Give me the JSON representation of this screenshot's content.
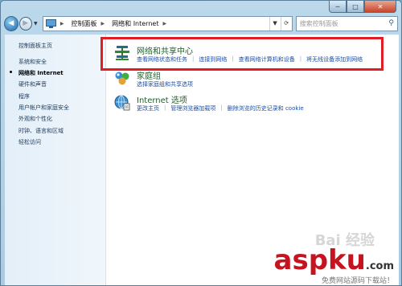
{
  "caption": {
    "minimize": "─",
    "maximize": "□",
    "close": "✕"
  },
  "breadcrumb": [
    "控制面板",
    "网络和 Internet"
  ],
  "search": {
    "placeholder": "搜索控制面板"
  },
  "left_pane": {
    "home": "控制面板主页",
    "items": [
      "系统和安全",
      "网络和 Internet",
      "硬件和声音",
      "程序",
      "用户帐户和家庭安全",
      "外观和个性化",
      "时钟、语言和区域",
      "轻松访问"
    ],
    "current_index": 1
  },
  "categories": [
    {
      "title": "网络和共享中心",
      "links": [
        "查看网络状态和任务",
        "连接到网络",
        "查看网络计算机和设备",
        "将无线设备添加到网络"
      ]
    },
    {
      "title": "家庭组",
      "links": [
        "选择家庭组和共享选项"
      ]
    },
    {
      "title": "Internet 选项",
      "links": [
        "更改主页",
        "管理浏览器加载项",
        "删除浏览的历史记录和 cookie"
      ]
    }
  ],
  "watermark": {
    "main": "aspku",
    "suffix": ".com",
    "sub": "免费网站源码下载站！",
    "baidu": "Bai 经验"
  },
  "colors": {
    "highlight": "#e11c24",
    "link": "#1a4ea8",
    "title": "#1e5e2a"
  }
}
